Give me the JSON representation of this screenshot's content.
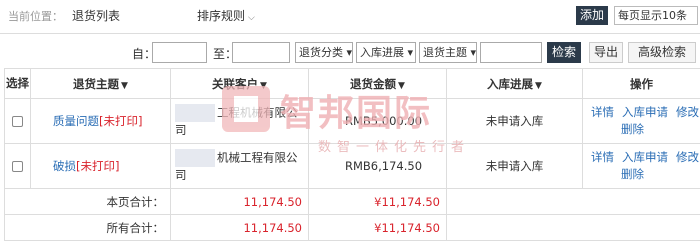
{
  "header": {
    "crumb_label": "当前位置：",
    "crumb_value": "退货列表",
    "sort_label": "排序规则",
    "add_label": "添加",
    "per_page": "每页显示10条"
  },
  "filters": {
    "from_label": "自：",
    "to_label": "至：",
    "category_select": "退货分类",
    "stock_select": "入库进展",
    "subject_select": "退货主题",
    "search_label": "检索",
    "export_label": "导出",
    "advanced_label": "高级检索"
  },
  "table": {
    "headers": {
      "select": "选择",
      "subject": "退货主题",
      "client": "关联客户",
      "amount": "退货金额",
      "progress": "入库进展",
      "ops": "操作"
    },
    "rows": [
      {
        "subject": "质量问题",
        "tag": "[未打印]",
        "client": "工程机械有限公司",
        "amount": "RMB5,000.00",
        "progress": "未申请入库",
        "op_detail": "详情",
        "op_apply": "入库申请",
        "op_edit": "修改",
        "op_delete": "删除"
      },
      {
        "subject": "破损",
        "tag": "[未打印]",
        "client": "机械工程有限公司",
        "amount": "RMB6,174.50",
        "progress": "未申请入库",
        "op_detail": "详情",
        "op_apply": "入库申请",
        "op_edit": "修改",
        "op_delete": "删除"
      }
    ],
    "page_total": {
      "label": "本页合计：",
      "value": "11,174.50",
      "amount": "¥11,174.50"
    },
    "all_total": {
      "label": "所有合计：",
      "value": "11,174.50",
      "amount": "¥11,174.50"
    }
  },
  "watermark": {
    "title": "智邦国际",
    "subtitle": "数智一体化先行者"
  },
  "colors": {
    "dark_button": "#2b3a4a",
    "link": "#2a6db5",
    "red": "#d9232c"
  }
}
